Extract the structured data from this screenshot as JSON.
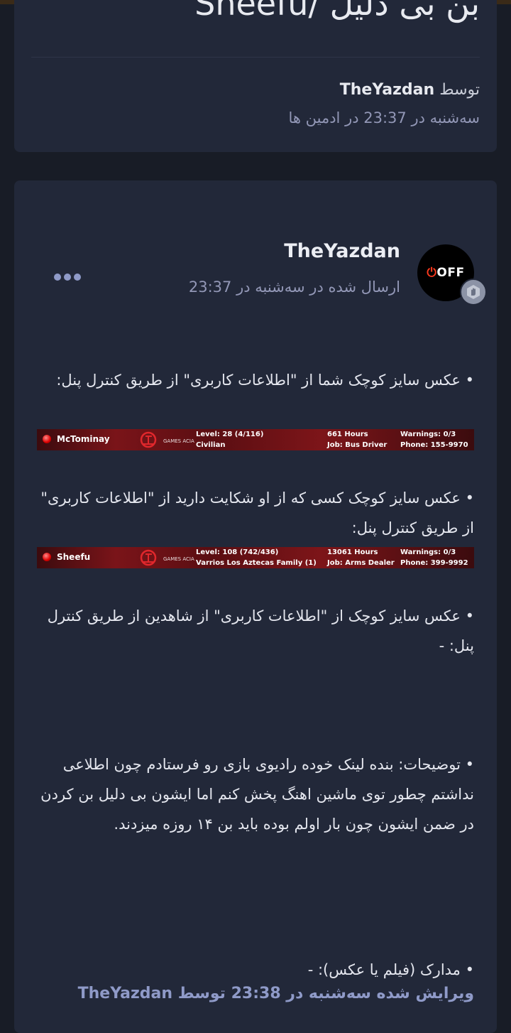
{
  "topic": {
    "title": "بن بی دلیل /Sheefu",
    "author_prefix": "توسط",
    "author": "TheYazdan",
    "meta": "سه‌شنبه در 23:37 در ادمین ها"
  },
  "post": {
    "avatar_text": "OFF",
    "poster": "TheYazdan",
    "date": "ارسال شده در سه‌شنبه در 23:37",
    "paragraphs": [
      "• عکس سایز کوچک شما از \"اطلاعات کاربری\" از طریق کنترل پنل:",
      "• عکس سایز کوچک کسی که از او شکایت دارید از \"اطلاعات کاربری\" از طریق کنترل پنل:",
      "• عکس سایز کوچک از \"اطلاعات کاربری\" از شاهدین از طریق کنترل پنل: -",
      "• توضیحات: بنده لینک خوده رادیوی بازی رو فرستادم چون اطلاعی نداشتم چطور توی ماشین اهنگ پخش کنم اما ایشون بی دلیل بن کردن در ضمن ایشون چون بار اولم بوده باید بن ۱۴ روزه میزدند.",
      "• مدارک (فیلم یا عکس): -"
    ],
    "stat_bars": [
      {
        "player": "McTominay",
        "logo_text": "GAMES ACIA",
        "level": "Level: 28 (4/116)",
        "faction": "Civilian",
        "hours": "661 Hours",
        "job": "Job: Bus Driver",
        "warnings": "Warnings: 0/3",
        "phone": "Phone: 155-9970"
      },
      {
        "player": "Sheefu",
        "logo_text": "GAMES ACIA",
        "level": "Level: 108 (742/436)",
        "faction": "Varrios Los Aztecas Family (1)",
        "hours": "13061 Hours",
        "job": "Job: Arms Dealer",
        "warnings": "Warnings: 0/3",
        "phone": "Phone: 399-9992"
      }
    ],
    "edited": "ویرایش شده سه‌شنبه در 23:38 توسط TheYazdan"
  },
  "colors": {
    "background": "#181c26",
    "card": "#222839",
    "accent": "#8f9ac8",
    "muted": "#9297b6"
  }
}
